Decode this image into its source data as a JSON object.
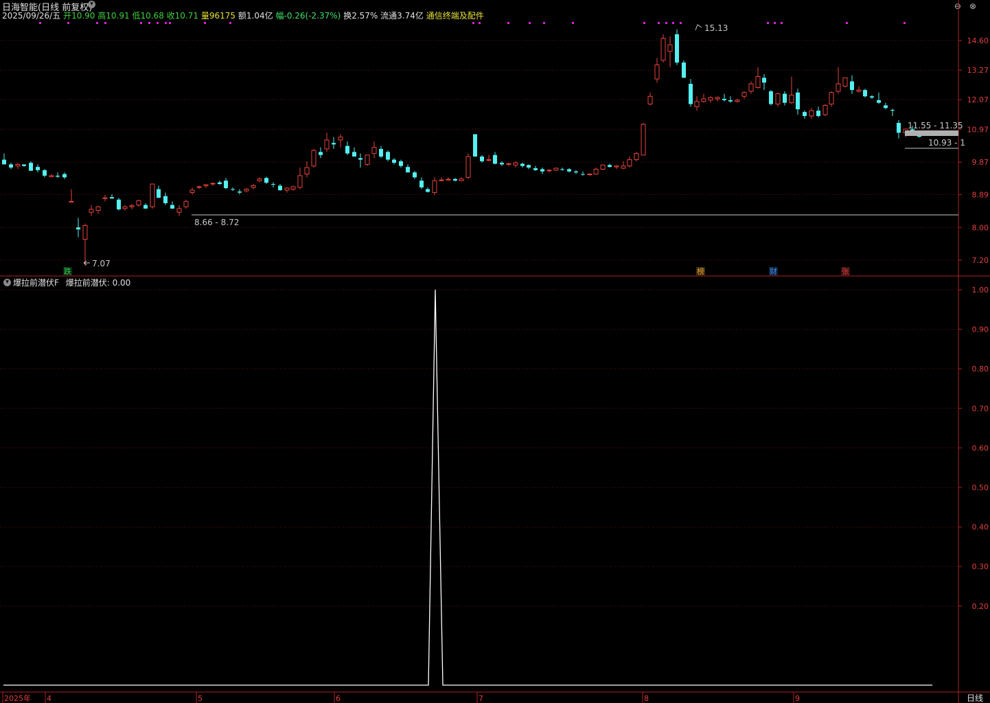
{
  "header": {
    "title": "日海智能(日线 前复权)",
    "date": "2025/09/26/五",
    "open_label": "开",
    "open": "10.90",
    "high_label": "高",
    "high": "10.91",
    "low_label": "低",
    "low": "10.68",
    "close_label": "收",
    "close": "10.71",
    "vol_label": "量",
    "vol": "96175",
    "amount_label": "额",
    "amount": "1.04亿",
    "change_label": "幅",
    "change": "-0.26(-2.37%)",
    "turnover_label": "换",
    "turnover": "2.57%",
    "float_label": "流通",
    "float_value": "3.74亿",
    "link": "通信终端及配件"
  },
  "window_controls": [
    "⊖",
    "⊗"
  ],
  "main_chart": {
    "price_ticks": [
      "14.60",
      "13.27",
      "12.07",
      "10.97",
      "9.87",
      "8.89",
      "8.00",
      "7.20"
    ],
    "annotations": {
      "high": "15.13",
      "low": "7.07",
      "support": "8.66 - 8.72",
      "resist1": "11.55 - 11.35",
      "resist2": "10.93 - 1"
    },
    "markers": [
      {
        "label": "跌",
        "color": "#2fd060"
      },
      {
        "label": "榜",
        "color": "#e0a030"
      },
      {
        "label": "财",
        "color": "#3a8ff0"
      },
      {
        "label": "张",
        "color": "#e04040"
      }
    ],
    "colors": {
      "up": "#e8453c",
      "down": "#54f0f0",
      "grid": "#7a1818",
      "axis": "#b52020"
    }
  },
  "indicator": {
    "name": "爆拉前潜伏F",
    "value_label": "爆拉前潜伏: 0.00",
    "ticks": [
      "1.00",
      "0.90",
      "0.80",
      "0.70",
      "0.60",
      "0.50",
      "0.40",
      "0.30",
      "0.20"
    ]
  },
  "time_axis": {
    "labels": [
      "2025年",
      "4",
      "5",
      "6",
      "7",
      "8",
      "9"
    ],
    "period_label": "日线"
  },
  "chart_data": {
    "type": "candlestick",
    "series": [
      {
        "name": "日海智能",
        "note": "daily OHLC, spans approx. Mar–Sep 2025, high 15.13, low 7.07"
      }
    ],
    "indicator_series": {
      "name": "爆拉前潜伏",
      "values_summary": "0 everywhere except a single spike to 1.00 in mid-June"
    }
  }
}
